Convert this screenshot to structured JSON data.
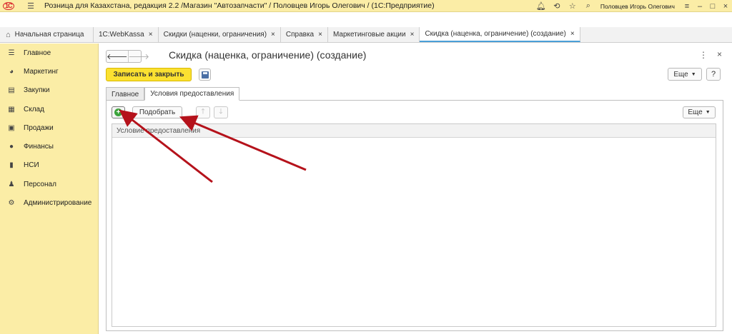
{
  "titlebar": {
    "logo": "1С",
    "title": "Розница для Казахстана, редакция 2.2 /Магазин \"Автозапчасти\" / Половцев Игорь Олегович /  (1С:Предприятие)",
    "user": "Половцев Игорь Олегович"
  },
  "tabs": [
    {
      "label": "Начальная страница"
    },
    {
      "label": "1C:WebKassa"
    },
    {
      "label": "Скидки (наценки, ограничения)"
    },
    {
      "label": "Справка"
    },
    {
      "label": "Маркетинговые акции"
    },
    {
      "label": "Скидка (наценка, ограничение) (создание)"
    }
  ],
  "tab_close": "×",
  "sidebar": {
    "items": [
      {
        "label": "Главное",
        "icon": "menu-lines-icon"
      },
      {
        "label": "Маркетинг",
        "icon": "pie-chart-icon"
      },
      {
        "label": "Закупки",
        "icon": "purchases-icon"
      },
      {
        "label": "Склад",
        "icon": "warehouse-icon"
      },
      {
        "label": "Продажи",
        "icon": "cart-icon"
      },
      {
        "label": "Финансы",
        "icon": "coin-icon"
      },
      {
        "label": "НСИ",
        "icon": "book-icon"
      },
      {
        "label": "Персонал",
        "icon": "person-icon"
      },
      {
        "label": "Администрирование",
        "icon": "gear-icon"
      }
    ]
  },
  "form": {
    "title": "Скидка (наценка, ограничение) (создание)",
    "save_close_label": "Записать и закрыть",
    "more_label": "Еще",
    "help_label": "?",
    "tabs": [
      {
        "label": "Главное"
      },
      {
        "label": "Условия предоставления"
      }
    ],
    "toolbar": {
      "pick_label": "Подобрать",
      "more_label": "Еще"
    },
    "grid": {
      "columns": [
        "Условие предоставления"
      ],
      "rows": []
    }
  },
  "annotation_color": "#b5121b"
}
